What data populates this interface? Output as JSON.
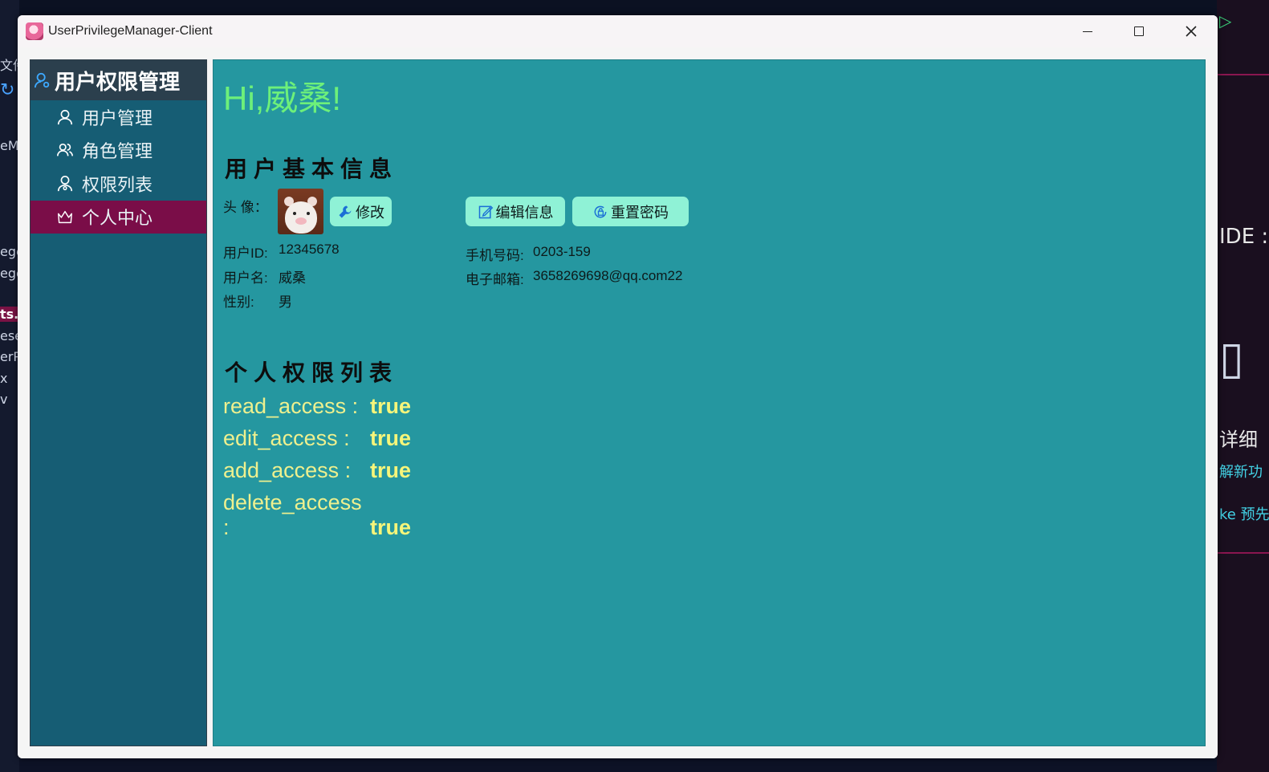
{
  "window": {
    "title": "UserPrivilegeManager-Client"
  },
  "sidebar": {
    "title": "用户权限管理",
    "items": [
      {
        "label": "用户管理",
        "icon": "user-icon"
      },
      {
        "label": "角色管理",
        "icon": "users-icon"
      },
      {
        "label": "权限列表",
        "icon": "permission-user-icon"
      },
      {
        "label": "个人中心",
        "icon": "crown-icon",
        "active": true
      }
    ]
  },
  "main": {
    "greeting": "Hi,威桑!",
    "basic_info": {
      "title": "用户基本信息",
      "avatar_label": "头 像：",
      "modify_button": "修改",
      "edit_button": "编辑信息",
      "reset_password_button": "重置密码",
      "fields_left": [
        {
          "label": "用户ID:",
          "value": "12345678"
        },
        {
          "label": "用户名:",
          "value": "威桑"
        },
        {
          "label": "性别:",
          "value": "男"
        }
      ],
      "fields_right": [
        {
          "label": "手机号码:",
          "value": "0203-159"
        },
        {
          "label": "电子邮箱:",
          "value": "3658269698@qq.com22"
        }
      ]
    },
    "permissions": {
      "title": "个人权限列表",
      "items": [
        {
          "key": "read_access :",
          "value": "true"
        },
        {
          "key": "edit_access :",
          "value": "true"
        },
        {
          "key": "add_access :",
          "value": "true"
        },
        {
          "key": "delete_access :",
          "value": "true"
        }
      ]
    }
  },
  "background": {
    "left_fragments": [
      "文件",
      "eMa",
      "ege",
      "ege",
      "ts.:",
      "eset",
      "erP",
      "x",
      "v"
    ],
    "right_fragments": [
      "IDE :",
      "详细",
      "解新功",
      "ke 预先"
    ]
  },
  "colors": {
    "sidebar_bg": "#165d74",
    "sidebar_header_bg": "#2b3f4d",
    "nav_active_bg": "#7a0d48",
    "main_bg": "#2597a0",
    "greeting": "#6df07a",
    "button_bg": "#8ff2d6",
    "permission_text": "#eef08e"
  }
}
